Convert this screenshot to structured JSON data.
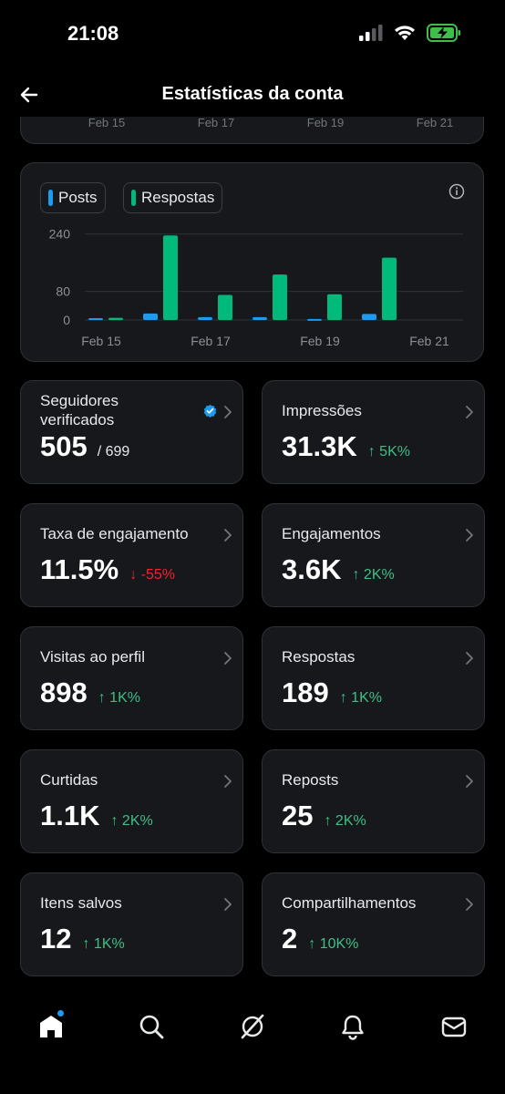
{
  "status_bar": {
    "time": "21:08"
  },
  "header": {
    "title": "Estatísticas da conta"
  },
  "prev_chart": {
    "ticks": [
      "Feb 15",
      "Feb 17",
      "Feb 19",
      "Feb 21"
    ]
  },
  "chart_data": {
    "type": "bar",
    "categories": [
      "Feb 15",
      "Feb 16",
      "Feb 17",
      "Feb 18",
      "Feb 19",
      "Feb 20",
      "Feb 21"
    ],
    "x_tick_labels": [
      "Feb 15",
      "Feb 17",
      "Feb 19",
      "Feb 21"
    ],
    "series": [
      {
        "name": "Posts",
        "color": "#1d9bf0",
        "values": [
          5,
          18,
          8,
          8,
          3,
          17
        ]
      },
      {
        "name": "Respostas",
        "color": "#00ba7c",
        "values": [
          6,
          236,
          70,
          127,
          72,
          174
        ]
      }
    ],
    "y_ticks": [
      0,
      80,
      240
    ],
    "ylim": [
      0,
      280
    ],
    "grid": true,
    "legend": "top-left"
  },
  "stats": [
    {
      "label": "Seguidores verificados",
      "label_lines": [
        "Seguidores",
        "verificados"
      ],
      "value": "505",
      "total": "/ 699",
      "change": "",
      "direction": "",
      "verified": true
    },
    {
      "label": "Impressões",
      "value": "31.3K",
      "change": "↑ 5K%",
      "direction": "up"
    },
    {
      "label": "Taxa de engajamento",
      "value": "11.5%",
      "change": "↓ -55%",
      "direction": "down"
    },
    {
      "label": "Engajamentos",
      "value": "3.6K",
      "change": "↑ 2K%",
      "direction": "up"
    },
    {
      "label": "Visitas ao perfil",
      "value": "898",
      "change": "↑ 1K%",
      "direction": "up"
    },
    {
      "label": "Respostas",
      "value": "189",
      "change": "↑ 1K%",
      "direction": "up"
    },
    {
      "label": "Curtidas",
      "value": "1.1K",
      "change": "↑ 2K%",
      "direction": "up"
    },
    {
      "label": "Reposts",
      "value": "25",
      "change": "↑ 2K%",
      "direction": "up"
    },
    {
      "label": "Itens salvos",
      "value": "12",
      "change": "↑ 1K%",
      "direction": "up"
    },
    {
      "label": "Compartilhamentos",
      "value": "2",
      "change": "↑ 10K%",
      "direction": "up"
    }
  ],
  "tab_bar": {
    "items": [
      "home-icon",
      "search-icon",
      "grok-icon",
      "notifications-icon",
      "messages-icon"
    ],
    "active": "home-icon"
  },
  "colors": {
    "accent": "#1d9bf0",
    "up": "#3fbf86",
    "down": "#f4212e",
    "card": "#16181c",
    "border": "#2f3336"
  }
}
